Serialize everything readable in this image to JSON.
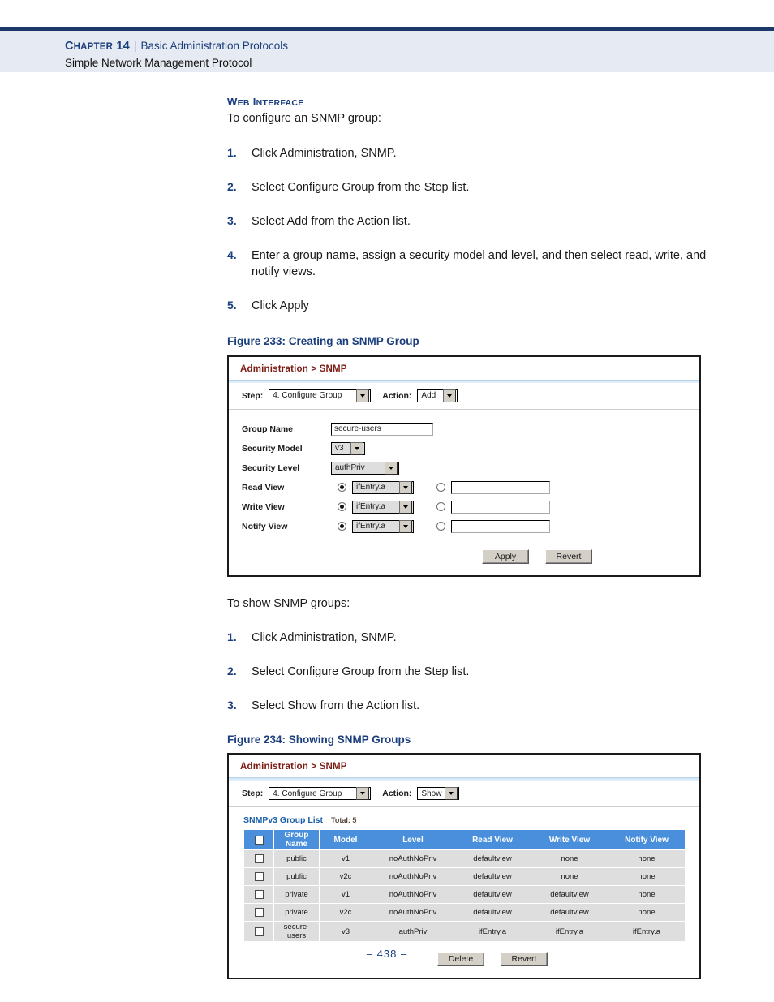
{
  "header": {
    "chapter_prefix": "C",
    "chapter_label_rest": "HAPTER",
    "chapter_number": "14",
    "separator": "|",
    "topic": "Basic Administration Protocols",
    "subtopic": "Simple Network Management Protocol"
  },
  "section": {
    "subhead_first_letters": "W",
    "subhead_rest_1": "EB",
    "subhead_second_letter": "I",
    "subhead_rest_2": "NTERFACE",
    "subhead_full": "WEB INTERFACE",
    "lead_1": "To configure an SNMP group:",
    "lead_2": "To show SNMP groups:"
  },
  "steps_configure": [
    {
      "num": "1.",
      "text": "Click Administration, SNMP."
    },
    {
      "num": "2.",
      "text": "Select Configure Group from the Step list."
    },
    {
      "num": "3.",
      "text": "Select Add from the Action list."
    },
    {
      "num": "4.",
      "text": "Enter a group name, assign a security model and level, and then select read, write, and notify views."
    },
    {
      "num": "5.",
      "text": "Click Apply"
    }
  ],
  "steps_show": [
    {
      "num": "1.",
      "text": "Click Administration, SNMP."
    },
    {
      "num": "2.",
      "text": "Select Configure Group from the Step list."
    },
    {
      "num": "3.",
      "text": "Select Show from the Action list."
    }
  ],
  "figure_233": {
    "caption": "Figure 233:  Creating an SNMP Group",
    "panel_title": "Administration > SNMP",
    "toolbar": {
      "step_label": "Step:",
      "step_value": "4. Configure Group",
      "action_label": "Action:",
      "action_value": "Add"
    },
    "fields": {
      "group_name_label": "Group Name",
      "group_name_value": "secure-users",
      "security_model_label": "Security Model",
      "security_model_value": "v3",
      "security_level_label": "Security Level",
      "security_level_value": "authPriv",
      "read_view_label": "Read View",
      "read_view_value": "ifEntry.a",
      "read_view_text": "",
      "write_view_label": "Write View",
      "write_view_value": "ifEntry.a",
      "write_view_text": "",
      "notify_view_label": "Notify View",
      "notify_view_value": "ifEntry.a",
      "notify_view_text": ""
    },
    "buttons": {
      "apply": "Apply",
      "revert": "Revert"
    }
  },
  "figure_234": {
    "caption": "Figure 234:  Showing SNMP Groups",
    "panel_title": "Administration > SNMP",
    "toolbar": {
      "step_label": "Step:",
      "step_value": "4. Configure Group",
      "action_label": "Action:",
      "action_value": "Show"
    },
    "list": {
      "title": "SNMPv3 Group List",
      "total": "Total: 5",
      "columns": [
        "",
        "Group Name",
        "Model",
        "Level",
        "Read View",
        "Write View",
        "Notify View"
      ],
      "rows": [
        {
          "group_name": "public",
          "model": "v1",
          "level": "noAuthNoPriv",
          "read_view": "defaultview",
          "write_view": "none",
          "notify_view": "none"
        },
        {
          "group_name": "public",
          "model": "v2c",
          "level": "noAuthNoPriv",
          "read_view": "defaultview",
          "write_view": "none",
          "notify_view": "none"
        },
        {
          "group_name": "private",
          "model": "v1",
          "level": "noAuthNoPriv",
          "read_view": "defaultview",
          "write_view": "defaultview",
          "notify_view": "none"
        },
        {
          "group_name": "private",
          "model": "v2c",
          "level": "noAuthNoPriv",
          "read_view": "defaultview",
          "write_view": "defaultview",
          "notify_view": "none"
        },
        {
          "group_name": "secure-users",
          "model": "v3",
          "level": "authPriv",
          "read_view": "ifEntry.a",
          "write_view": "ifEntry.a",
          "notify_view": "ifEntry.a"
        }
      ]
    },
    "buttons": {
      "delete": "Delete",
      "revert": "Revert"
    }
  },
  "footer": {
    "page": "–  438  –"
  },
  "colors": {
    "header_band": "#e6eaf2",
    "header_rule": "#1b3868",
    "heading_blue": "#1b3f7d",
    "panel_title_red": "#7b1b12",
    "table_header_blue": "#4a8fdc",
    "table_row_grey": "#dedede",
    "list_title_blue": "#1b5fa8"
  }
}
